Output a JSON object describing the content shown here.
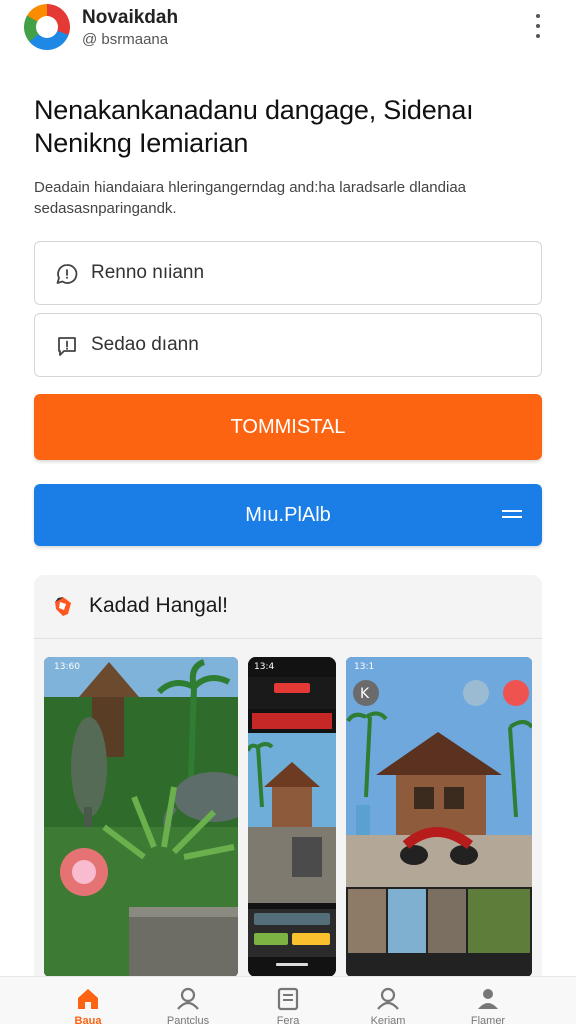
{
  "header": {
    "app_name": "Novaikdah",
    "handle": "@ bsrmaana"
  },
  "main": {
    "headline_line1": "Nenakankanadanu dangage, Sidenaı",
    "headline_line2": "Nenikng Iemiarian",
    "description_line1": "Deadain hiandaiara hleringangerndag and:ha laradsarle dlandiaa",
    "description_line2": "sedasasnparingandk.",
    "field1_text": "Renno nıiann",
    "field2_text": "Sedao dıann",
    "primary_button": "TOMMISTAL",
    "secondary_button": "Mıu.PlAlb"
  },
  "gallery": {
    "title": "Kadad Hangal!",
    "shots": [
      {
        "time": "13:60"
      },
      {
        "time": "13:4"
      },
      {
        "time": "13:1"
      }
    ]
  },
  "bottom_nav": [
    {
      "label": "Baua",
      "icon": "home-icon",
      "active": true
    },
    {
      "label": "Pantclus",
      "icon": "user-search-icon",
      "active": false
    },
    {
      "label": "Fera",
      "icon": "document-icon",
      "active": false
    },
    {
      "label": "Keriam",
      "icon": "profile-search-icon",
      "active": false
    },
    {
      "label": "Flamer",
      "icon": "person-icon",
      "active": false
    }
  ],
  "colors": {
    "primary_orange": "#fd6412",
    "primary_blue": "#1a7ee6"
  }
}
